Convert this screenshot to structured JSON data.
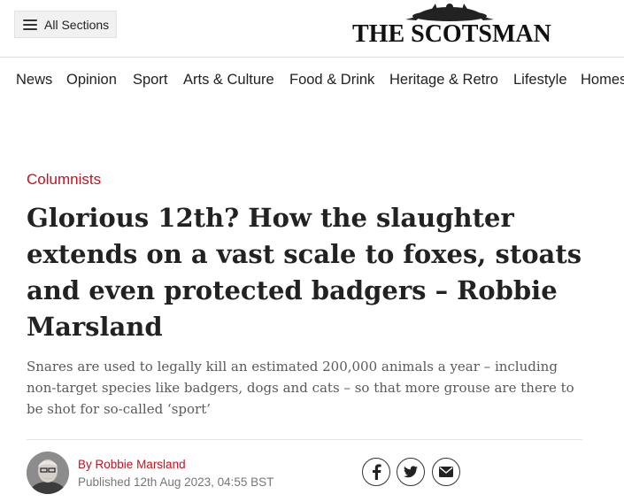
{
  "header": {
    "menu_label": "All Sections",
    "logo_text": "THE SCOTSMAN"
  },
  "nav": {
    "items": [
      "News",
      "Opinion",
      "Sport",
      "Arts & Culture",
      "Food & Drink",
      "Heritage & Retro",
      "Lifestyle",
      "Homes"
    ]
  },
  "article": {
    "kicker": "Columnists",
    "headline": "Glorious 12th? How the slaughter extends on a vast scale to foxes, stoats and even protected badgers – Robbie Marsland",
    "standfirst": "Snares are used to legally kill an estimated 200,000 animals a year – including non-target species like badgers, dogs and cats – so that more grouse are there to be shot for so-called ‘sport’",
    "byline_prefix": "By",
    "author": "Robbie Marsland",
    "published": "Published 12th Aug 2023, 04:55 BST"
  },
  "share": {
    "icons": [
      "facebook-icon",
      "twitter-icon",
      "email-icon"
    ]
  },
  "colors": {
    "accent": "#c1121f",
    "text": "#222222",
    "muted": "#5a5a5a"
  }
}
